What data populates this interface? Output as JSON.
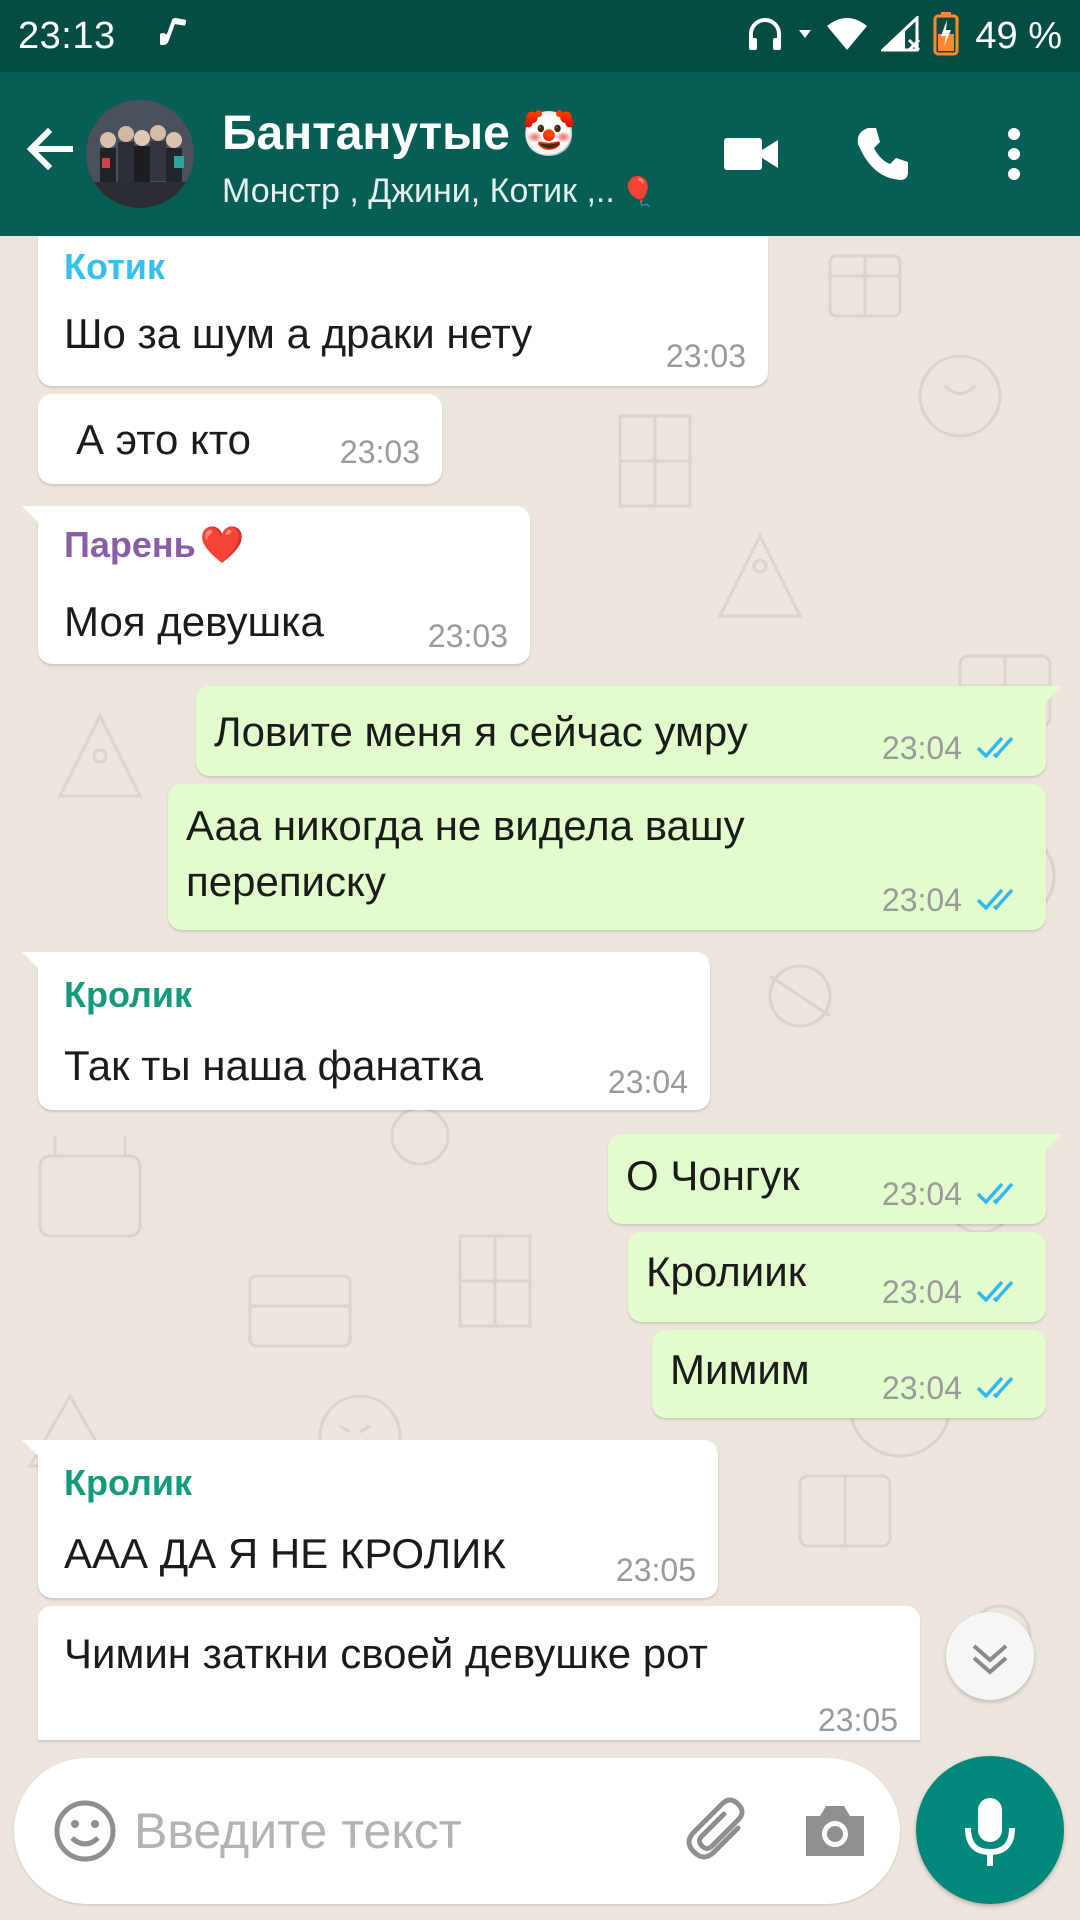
{
  "status_bar": {
    "time": "23:13",
    "battery_percent": "49 %",
    "battery_level": 0.49,
    "icons": [
      "music-note-icon",
      "headset-icon",
      "wifi-icon",
      "signal-icon",
      "battery-icon"
    ]
  },
  "header": {
    "title": "Бантанутые",
    "title_emoji": "🤡",
    "members": "Монстр , Джини, Котик ,..",
    "members_emoji": "🎈",
    "icons": [
      "back-arrow-icon",
      "video-call-icon",
      "phone-icon",
      "more-vert-icon"
    ]
  },
  "colors": {
    "header": "#075e54",
    "status_bar": "#054d44",
    "outgoing_bubble": "#e2fdcb",
    "incoming_bubble": "#ffffff",
    "read_ticks": "#34b7f1",
    "mic_button": "#00897b",
    "chat_background": "#ece5dd"
  },
  "messages": [
    {
      "dir": "in",
      "sender": "Котик",
      "sender_color": "#35c0f0",
      "text": "Шо за шум а драки нету",
      "time": "23:03"
    },
    {
      "dir": "in",
      "sender": "",
      "text": "А это кто",
      "time": "23:03"
    },
    {
      "dir": "in",
      "sender": "Парень",
      "sender_emoji": "❤️",
      "sender_color": "#8a5ea6",
      "text": "Моя девушка",
      "time": "23:03"
    },
    {
      "dir": "out",
      "text": "Ловите меня я сейчас умру",
      "time": "23:04",
      "status": "read"
    },
    {
      "dir": "out",
      "text_line1": "Ааа никогда не видела вашу",
      "text_line2": "переписку",
      "time": "23:04",
      "status": "read"
    },
    {
      "dir": "in",
      "sender": "Кролик",
      "sender_color": "#139b7c",
      "text": "Так ты наша фанатка",
      "time": "23:04"
    },
    {
      "dir": "out",
      "text": "О Чонгук",
      "time": "23:04",
      "status": "read"
    },
    {
      "dir": "out",
      "text": "Кролиик",
      "time": "23:04",
      "status": "read"
    },
    {
      "dir": "out",
      "text": "Мимим",
      "time": "23:04",
      "status": "read"
    },
    {
      "dir": "in",
      "sender": "Кролик",
      "sender_color": "#139b7c",
      "text": "ААА ДА Я НЕ КРОЛИК",
      "time": "23:05"
    },
    {
      "dir": "in",
      "sender": "",
      "text": "Чимин заткни своей девушке рот",
      "time": "23:05"
    }
  ],
  "input": {
    "placeholder": "Введите текст",
    "value": "",
    "icons": [
      "emoji-icon",
      "attach-icon",
      "camera-icon",
      "mic-icon"
    ]
  }
}
